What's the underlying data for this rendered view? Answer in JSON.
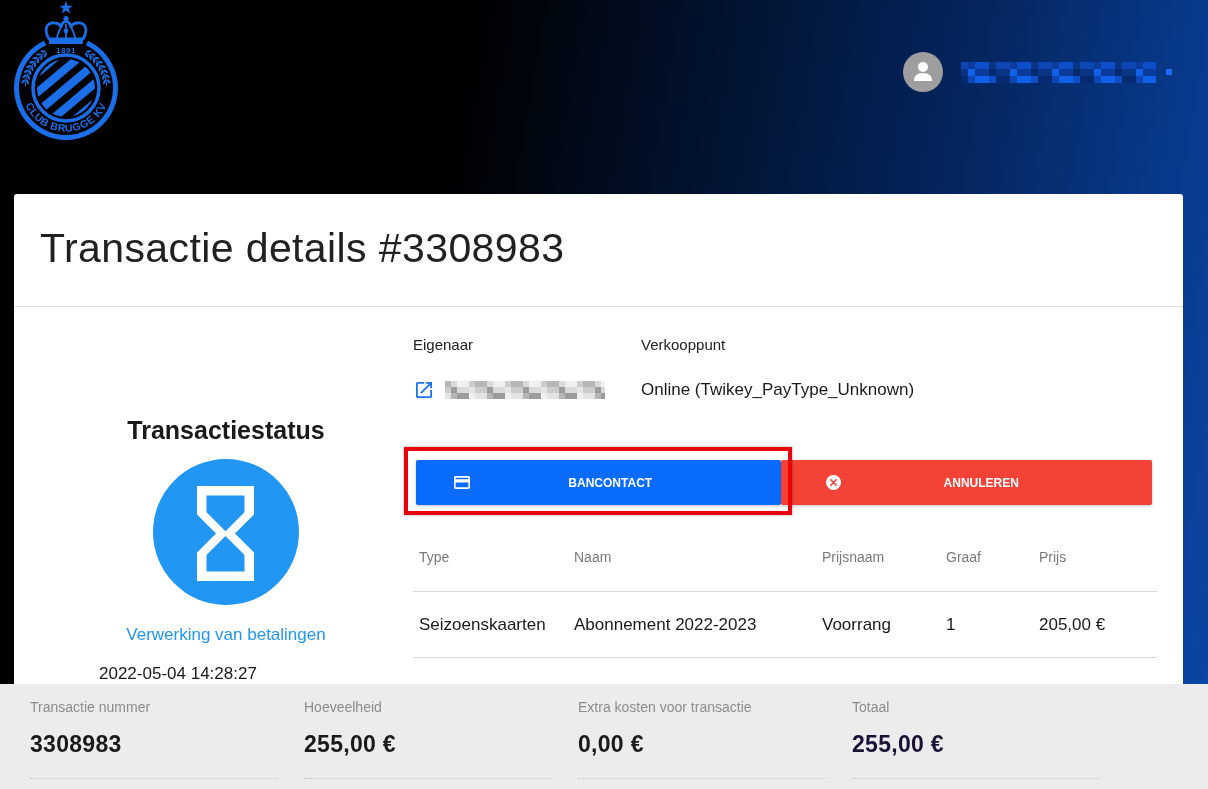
{
  "header": {
    "logo": {
      "text": "CLUB BRUGGE KV",
      "year": "1891"
    }
  },
  "title": "Transactie details #3308983",
  "status": {
    "heading": "Transactiestatus",
    "label": "Verwerking van betalingen",
    "timestamp": "2022-05-04 14:28:27"
  },
  "details": [
    {
      "kind": "link",
      "label": "Eigenaar"
    },
    {
      "kind": "text",
      "label": "Verkooppunt",
      "value": "Online (Twikey_PayType_Unknown)"
    }
  ],
  "actions": [
    {
      "kind": "pay",
      "label": "BANCONTACT",
      "highlighted": true
    },
    {
      "kind": "cancel",
      "label": "ANNULEREN",
      "highlighted": false
    }
  ],
  "table": {
    "columns": [
      "Type",
      "Naam",
      "Prijsnaam",
      "Graaf",
      "Prijs"
    ],
    "rows": [
      [
        "Seizoenskaarten",
        "Abonnement 2022-2023",
        "Voorrang",
        "1",
        "205,00 €"
      ]
    ]
  },
  "summary": [
    {
      "label": "Transactie nummer",
      "value": "3308983",
      "highlight": false
    },
    {
      "label": "Hoeveelheid",
      "value": "255,00 €",
      "highlight": false
    },
    {
      "label": "Extra kosten voor transactie",
      "value": "0,00 €",
      "highlight": false
    },
    {
      "label": "Totaal",
      "value": "255,00 €",
      "highlight": true
    }
  ]
}
